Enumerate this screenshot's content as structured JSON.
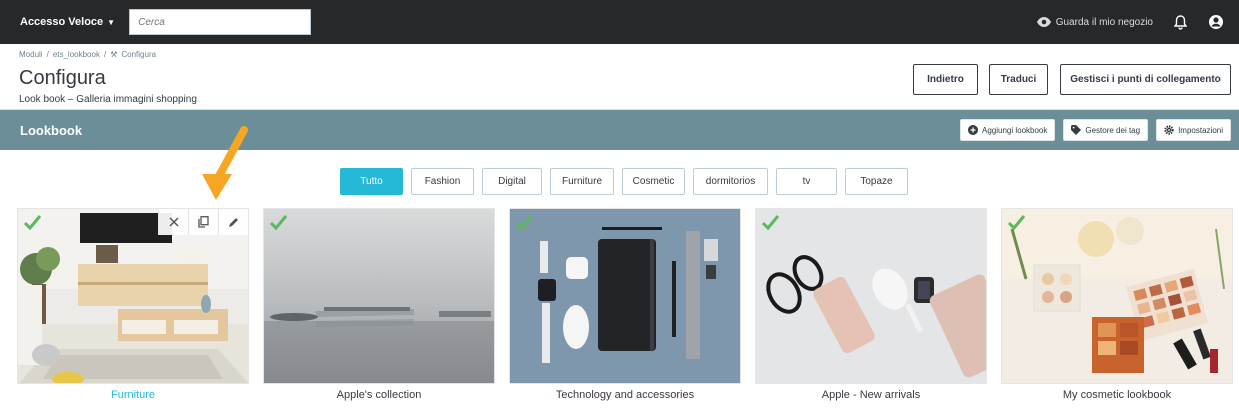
{
  "topbar": {
    "quick_access": "Accesso Veloce",
    "search_placeholder": "Cerca",
    "view_shop": "Guarda il mio negozio"
  },
  "header": {
    "breadcrumb": [
      "Moduli",
      "ets_lookbook",
      "Configura"
    ],
    "title": "Configura",
    "subtitle": "Look book – Galleria immagini shopping",
    "buttons": {
      "back": "Indietro",
      "translate": "Traduci",
      "manage_links": "Gestisci i punti di collegamento"
    }
  },
  "toolbar": {
    "title": "Lookbook",
    "add": "Aggiungi lookbook",
    "tags": "Gestore dei tag",
    "settings": "Impostazioni"
  },
  "filters": [
    "Tutto",
    "Fashion",
    "Digital",
    "Furniture",
    "Cosmetic",
    "dormitorios",
    "tv",
    "Topaze"
  ],
  "active_filter": "Tutto",
  "cards": [
    {
      "caption": "Furniture",
      "icon": "living-room-photo"
    },
    {
      "caption": "Apple's collection",
      "icon": "laptop-photo"
    },
    {
      "caption": "Technology and accessories",
      "icon": "tech-flatlay-photo"
    },
    {
      "caption": "Apple - New arrivals",
      "icon": "apple-products-photo"
    },
    {
      "caption": "My cosmetic lookbook",
      "icon": "cosmetics-photo"
    }
  ],
  "colors": {
    "accent": "#25b9d7",
    "toolbar": "#6b8e99",
    "topbar": "#26282a",
    "check": "#5cb85c",
    "arrow": "#f5a623"
  }
}
